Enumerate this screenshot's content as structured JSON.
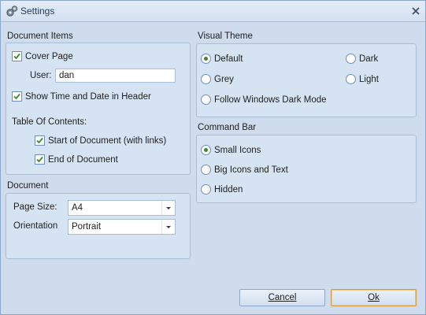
{
  "window": {
    "title": "Settings",
    "icon": "gear-icon",
    "close_icon": "close-icon"
  },
  "document_items": {
    "title": "Document Items",
    "cover_page": {
      "label": "Cover Page",
      "checked": true
    },
    "user": {
      "label": "User:",
      "value": "dan"
    },
    "show_time_date": {
      "label": "Show Time and Date in Header",
      "checked": true
    },
    "toc_label": "Table Of Contents:",
    "start_of_document": {
      "label": "Start of Document (with links)",
      "checked": true
    },
    "end_of_document": {
      "label": "End of Document",
      "checked": true
    }
  },
  "document": {
    "title": "Document",
    "page_size": {
      "label": "Page Size:",
      "value": "A4"
    },
    "orientation": {
      "label": "Orientation",
      "value": "Portrait"
    }
  },
  "visual_theme": {
    "title": "Visual Theme",
    "options": [
      {
        "label": "Default",
        "selected": true
      },
      {
        "label": "Dark",
        "selected": false
      },
      {
        "label": "Grey",
        "selected": false
      },
      {
        "label": "Light",
        "selected": false
      },
      {
        "label": "Follow Windows Dark Mode",
        "selected": false
      }
    ]
  },
  "command_bar": {
    "title": "Command Bar",
    "options": [
      {
        "label": "Small Icons",
        "selected": true
      },
      {
        "label": "Big Icons and Text",
        "selected": false
      },
      {
        "label": "Hidden",
        "selected": false
      }
    ]
  },
  "buttons": {
    "cancel": "Cancel",
    "ok": "Ok"
  },
  "colors": {
    "accent_check": "#3d8a2e",
    "window_bg": "#cfdcee",
    "default_button_border": "#d49a3a"
  }
}
